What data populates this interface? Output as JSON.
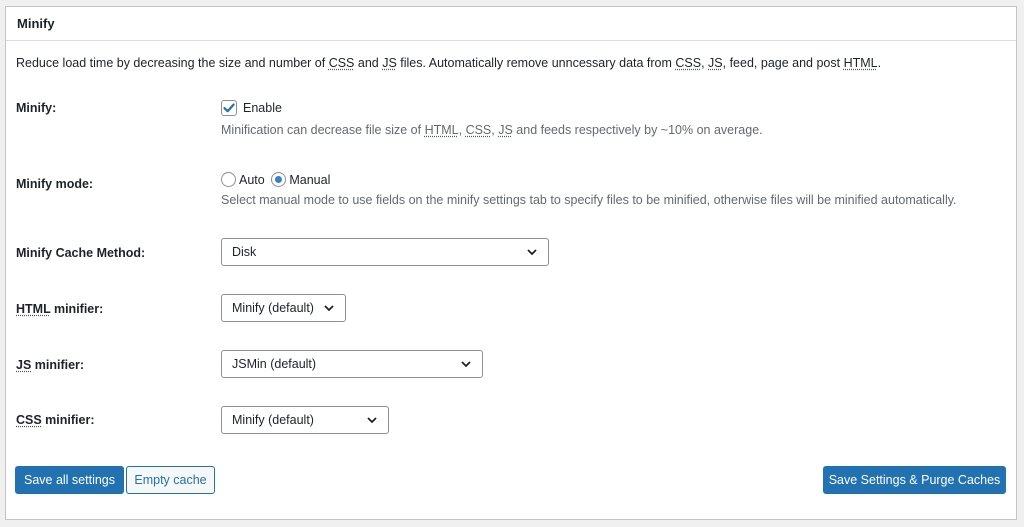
{
  "panel": {
    "title": "Minify",
    "description": {
      "p1": "Reduce load time by decreasing the size and number of ",
      "css": "CSS",
      "p2": " and ",
      "js": "JS",
      "p3": " files. Automatically remove unncessary data from ",
      "css2": "CSS",
      "p4": ", ",
      "js2": "JS",
      "p5": ", feed, page and post ",
      "html": "HTML",
      "p6": "."
    }
  },
  "minify": {
    "label": "Minify:",
    "checkbox_label": "Enable",
    "checked": true,
    "help": {
      "p1": "Minification can decrease file size of ",
      "html": "HTML",
      "p2": ", ",
      "css": "CSS",
      "p3": ", ",
      "js": "JS",
      "p4": " and feeds respectively by ~10% on average."
    }
  },
  "mode": {
    "label": "Minify mode:",
    "options": [
      "Auto",
      "Manual"
    ],
    "selected": "Manual",
    "help": "Select manual mode to use fields on the minify settings tab to specify files to be minified, otherwise files will be minified automatically."
  },
  "cache_method": {
    "label": "Minify Cache Method:",
    "value": "Disk"
  },
  "html_minifier": {
    "label_abbr": "HTML",
    "label_rest": " minifier:",
    "value": "Minify (default)"
  },
  "js_minifier": {
    "label_abbr": "JS",
    "label_rest": " minifier:",
    "value": "JSMin (default)"
  },
  "css_minifier": {
    "label_abbr": "CSS",
    "label_rest": " minifier:",
    "value": "Minify (default)"
  },
  "buttons": {
    "save_all": "Save all settings",
    "empty_cache": "Empty cache",
    "save_purge": "Save Settings & Purge Caches"
  },
  "colors": {
    "primary": "#2271b1",
    "accent_radio": "#3582c4"
  }
}
